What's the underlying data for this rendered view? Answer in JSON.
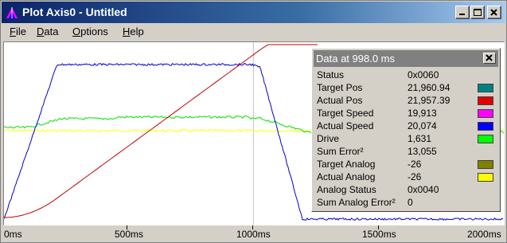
{
  "window": {
    "title": "Plot Axis0 - Untitled",
    "controls": [
      "minimize",
      "maximize",
      "close"
    ]
  },
  "menu": [
    {
      "label": "File",
      "accel": "F",
      "rest": "ile"
    },
    {
      "label": "Data",
      "accel": "D",
      "rest": "ata"
    },
    {
      "label": "Options",
      "accel": "O",
      "rest": "ptions"
    },
    {
      "label": "Help",
      "accel": "H",
      "rest": "elp"
    }
  ],
  "axis": {
    "ticks": [
      "0ms",
      "500ms",
      "1000ms",
      "1500ms",
      "2000ms"
    ],
    "cursor_ms": 998.0
  },
  "data_panel": {
    "title": "Data at 998.0 ms",
    "rows": [
      {
        "label": "Status",
        "value": "0x0060",
        "color": ""
      },
      {
        "label": "Target Pos",
        "value": "21,960.94",
        "color": "#008080"
      },
      {
        "label": "Actual Pos",
        "value": "21,957.39",
        "color": "#e00000"
      },
      {
        "label": "Target Speed",
        "value": "19,913",
        "color": "#ff00ff"
      },
      {
        "label": "Actual Speed",
        "value": "20,074",
        "color": "#0000ff"
      },
      {
        "label": "Drive",
        "value": "1,631",
        "color": "#00ff00"
      },
      {
        "label": "Sum Error²",
        "value": "13,055",
        "color": ""
      },
      {
        "label": "Target Analog",
        "value": "-26",
        "color": "#808000"
      },
      {
        "label": "Actual Analog",
        "value": "-26",
        "color": "#ffff00"
      },
      {
        "label": "Analog Status",
        "value": "0x0040",
        "color": ""
      },
      {
        "label": "Sum Analog Error²",
        "value": "0",
        "color": ""
      }
    ]
  },
  "colors": {
    "actual_speed": "#0000cc",
    "actual_pos": "#c00000",
    "drive": "#00e000",
    "actual_analog": "#ffff00",
    "cursor": "#c0c0c0"
  }
}
